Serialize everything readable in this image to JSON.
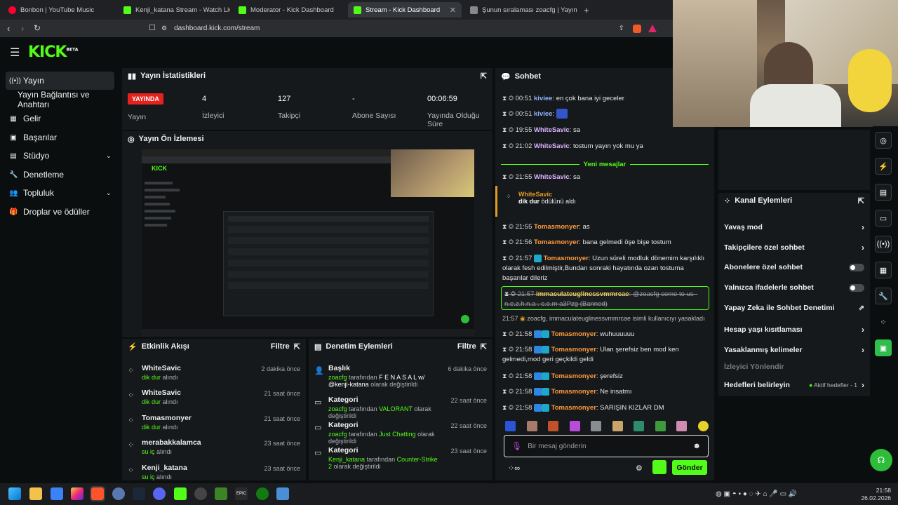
{
  "browser": {
    "tabs": [
      {
        "label": "Bonbon | YouTube Music",
        "color": "#ff0033"
      },
      {
        "label": "Kenji_katana Stream - Watch Live",
        "color": "#53fc18"
      },
      {
        "label": "Moderator - Kick Dashboard",
        "color": "#53fc18"
      },
      {
        "label": "Stream - Kick Dashboard",
        "color": "#53fc18"
      },
      {
        "label": "Şunun sıralaması zoacfg | Yayının g",
        "color": "#888888"
      }
    ],
    "url": "dashboard.kick.com/stream"
  },
  "kick": {
    "logo": "KICK",
    "beta": "BETA"
  },
  "sidebar": {
    "items": [
      {
        "label": "Yayın",
        "icon": "broadcast-icon"
      },
      {
        "label": "Yayın Bağlantısı ve Anahtarı",
        "icon": ""
      },
      {
        "label": "Gelir",
        "icon": "revenue-icon"
      },
      {
        "label": "Başarılar",
        "icon": "trophy-icon"
      },
      {
        "label": "Stüdyo",
        "icon": "studio-icon"
      },
      {
        "label": "Denetleme",
        "icon": "wrench-icon"
      },
      {
        "label": "Topluluk",
        "icon": "community-icon"
      },
      {
        "label": "Droplar ve ödüller",
        "icon": "gift-icon"
      }
    ]
  },
  "stats": {
    "title": "Yayın İstatistikleri",
    "live_badge": "YAYINDA",
    "live_label": "Yayın",
    "viewers": {
      "value": "4",
      "label": "İzleyici"
    },
    "followers": {
      "value": "127",
      "label": "Takipçi"
    },
    "subs": {
      "value": "-",
      "label": "Abone Sayısı"
    },
    "uptime": {
      "value": "00:06:59",
      "label": "Yayında Olduğu Süre"
    }
  },
  "preview": {
    "title": "Yayın Ön İzlemesi"
  },
  "activity": {
    "title": "Etkinlik Akışı",
    "filter": "Filtre",
    "items": [
      {
        "name": "WhiteSavic",
        "reward": "dik dur",
        "action": "alındı",
        "time": "2 dakika önce"
      },
      {
        "name": "WhiteSavic",
        "reward": "dik dur",
        "action": "alındı",
        "time": "21 saat önce"
      },
      {
        "name": "Tomasmonyer",
        "reward": "dik dur",
        "action": "alındı",
        "time": "21 saat önce"
      },
      {
        "name": "merabakkalamca",
        "reward": "su iç",
        "action": "alındı",
        "time": "23 saat önce"
      },
      {
        "name": "Kenji_katana",
        "reward": "su iç",
        "action": "alındı",
        "time": "23 saat önce"
      }
    ]
  },
  "modlog": {
    "title": "Denetim Eylemleri",
    "filter": "Filtre",
    "items": [
      {
        "type": "Başlık",
        "actor": "zoacfg",
        "mid": "tarafından",
        "value": "F E N A S A L w/ @kenji-katana",
        "end": "olarak değiştirildi",
        "time": "6 dakika önce"
      },
      {
        "type": "Kategori",
        "actor": "zoacfg",
        "mid": "tarafından",
        "value": "VALORANT",
        "end": "olarak değiştirildi",
        "time": "22 saat önce"
      },
      {
        "type": "Kategori",
        "actor": "zoacfg",
        "mid": "tarafından",
        "value": "Just Chatting",
        "end": "olarak değiştirildi",
        "time": "22 saat önce"
      },
      {
        "type": "Kategori",
        "actor": "Kenji_katana",
        "mid": "tarafından",
        "value": "Counter-Strike 2",
        "end": "olarak değiştirildi",
        "time": "23 saat önce"
      }
    ]
  },
  "chat": {
    "title": "Sohbet",
    "new_messages": "Yeni mesajlar",
    "messages": [
      {
        "time": "00:51",
        "user": "kiviee",
        "color": "#8fb3ff",
        "text": "en çok bana iyi geceler"
      },
      {
        "time": "00:51",
        "user": "kiviee",
        "color": "#8fb3ff",
        "text": ""
      },
      {
        "time": "19:55",
        "user": "WhiteSavic",
        "color": "#d9b3ff",
        "text": "sa"
      },
      {
        "time": "21:02",
        "user": "WhiteSavic",
        "color": "#d9b3ff",
        "text": "tostum yayın yok mu ya"
      },
      {
        "time": "21:55",
        "user": "WhiteSavic",
        "color": "#d9b3ff",
        "text": "sa"
      },
      {
        "time": "21:55",
        "user": "Tomasmonyer",
        "color": "#ff9a3c",
        "text": "as"
      },
      {
        "time": "21:56",
        "user": "Tomasmonyer",
        "color": "#ff9a3c",
        "text": "bana gelmedi öşe bişe tostum"
      },
      {
        "time": "21:57",
        "user": "Tomasmonyer",
        "color": "#ff9a3c",
        "text": "Uzun süreli modluk dönemim karşılıklı olarak fesh edilmiştir,Bundan sonraki hayatında ozan tostuma başarılar dileriz"
      },
      {
        "time": "21:57",
        "user": "immaculateuglinessvmmrcae",
        "color": "#ffd84a",
        "text": "@zoacfg come to us - n.e.z.h.n.a . c.o.m a3Pzg",
        "banned": "(Banned)"
      },
      {
        "time": "21:58",
        "user": "Tomasmonyer",
        "color": "#ff9a3c",
        "text": "wuhuuuuuu"
      },
      {
        "time": "21:58",
        "user": "Tomasmonyer",
        "color": "#ff9a3c",
        "text": "Ulan şerefsiz ben mod ken gelmedi,mod geri geçkildi geldi"
      },
      {
        "time": "21:58",
        "user": "Tomasmonyer",
        "color": "#ff9a3c",
        "text": "şerefsiz"
      },
      {
        "time": "21:58",
        "user": "Tomasmonyer",
        "color": "#ff9a3c",
        "text": "Ne insatmı"
      },
      {
        "time": "21:58",
        "user": "Tomasmonyer",
        "color": "#ff9a3c",
        "text": "SARIŞIN KIZLAR DM"
      }
    ],
    "reward": {
      "user": "WhiteSavic",
      "reward": "dik dur",
      "suffix": "ödülünü aldı"
    },
    "ban_notice": {
      "time": "21:57",
      "actor": "zoacfg,",
      "target": "immaculateuglinessvmmrcae",
      "rest": "isimli kullanıcıyı yasakladı"
    },
    "input_placeholder": "Bir mesaj gönderin",
    "send": "Gönder"
  },
  "actions": {
    "title": "Kanal Eylemleri",
    "items": [
      {
        "label": "Yavaş mod",
        "control": "arrow"
      },
      {
        "label": "Takipçilere özel sohbet",
        "control": "arrow"
      },
      {
        "label": "Abonelere özel sohbet",
        "control": "toggle"
      },
      {
        "label": "Yalnızca ifadelerle sohbet",
        "control": "toggle"
      },
      {
        "label": "Yapay Zeka ile Sohbet Denetimi",
        "control": "external"
      },
      {
        "label": "Hesap yaşı kısıtlaması",
        "control": "arrow"
      },
      {
        "label": "Yasaklanmış kelimeler",
        "control": "arrow"
      }
    ],
    "redirect": "İzleyici Yönlendir",
    "targets": "Hedefleri belirleyin",
    "targets_status": "Aktif hedefler - 1"
  },
  "taskbar": {
    "time": "21:58",
    "date": "26.02.2026"
  },
  "colors": {
    "accent": "#53fc18",
    "live": "#e4221e"
  }
}
